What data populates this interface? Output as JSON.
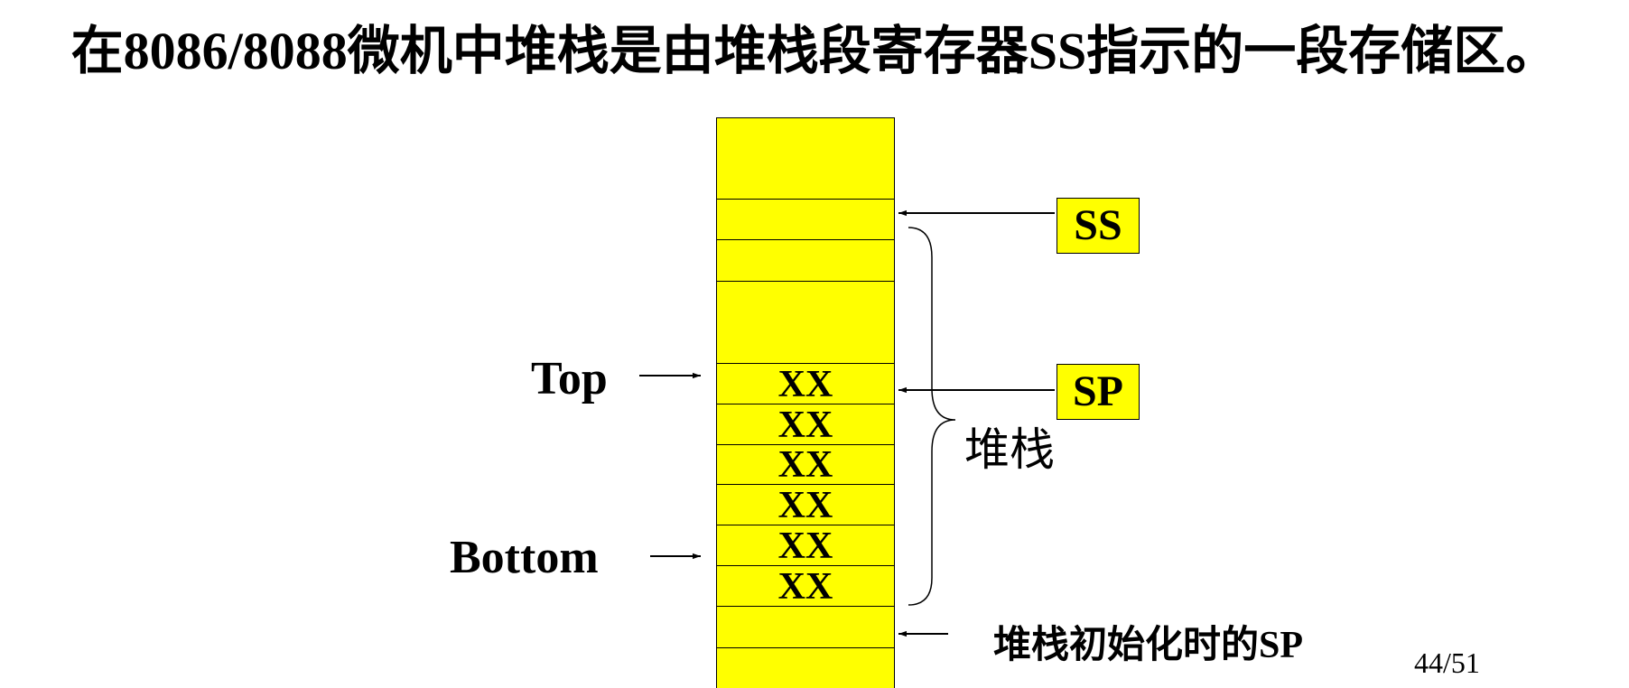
{
  "title": "在8086/8088微机中堆栈是由堆栈段寄存器SS指示的一段存储区。",
  "stack": {
    "cells": [
      "XX",
      "XX",
      "XX",
      "XX",
      "XX",
      "XX"
    ]
  },
  "labels": {
    "ss": "SS",
    "sp": "SP",
    "top": "Top",
    "bottom": "Bottom",
    "stack_name": "堆栈",
    "initial_sp": "堆栈初始化时的SP"
  },
  "page_number": "44/51",
  "colors": {
    "fill": "#ffff00",
    "stroke": "#000000"
  }
}
